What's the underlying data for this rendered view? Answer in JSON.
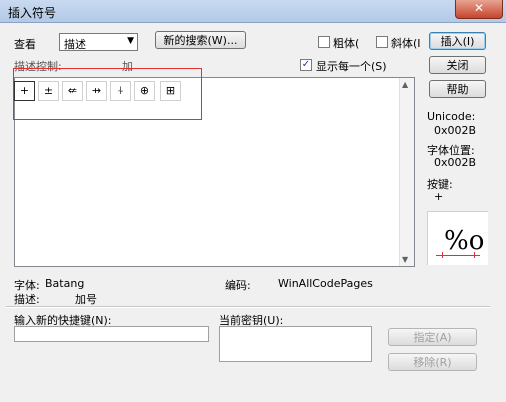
{
  "window": {
    "title": "插入符号",
    "close_glyph": "✕"
  },
  "view": {
    "label": "查看",
    "selected": "描述",
    "arrow": "▼"
  },
  "buttons": {
    "new_search": "新的搜索(W)...",
    "insert": "插入(I)",
    "close": "关闭",
    "help": "帮助",
    "assign": "指定(A)",
    "remove": "移除(R)"
  },
  "checkboxes": {
    "bold": "粗体(",
    "italic": "斜体(I",
    "show_each": "显示每一个(S)",
    "show_each_checked": true
  },
  "desc_control": {
    "label": "描述控制:",
    "value": "加"
  },
  "symbols": [
    "+",
    "±",
    "⇍",
    "⇸",
    "⍭",
    "⊕",
    "⊞"
  ],
  "scroll": {
    "up": "▲",
    "down": "▼"
  },
  "info": {
    "unicode_label": "Unicode:",
    "unicode_value": "0x002B",
    "char_pos_label": "字体位置:",
    "char_pos_value": "0x002B",
    "key_label": "按键:",
    "key_value": "+",
    "preview_glyph": "%o"
  },
  "font": {
    "font_label": "字体:",
    "font_value": "Batang",
    "encoding_label": "编码:",
    "encoding_value": "WinAllCodePages",
    "desc_label": "描述:",
    "desc_value": "加号"
  },
  "shortcut": {
    "new_label": "输入新的快捷键(N):",
    "new_value": "",
    "current_label": "当前密钥(U):"
  },
  "colors": {
    "highlight": "#e03030"
  }
}
